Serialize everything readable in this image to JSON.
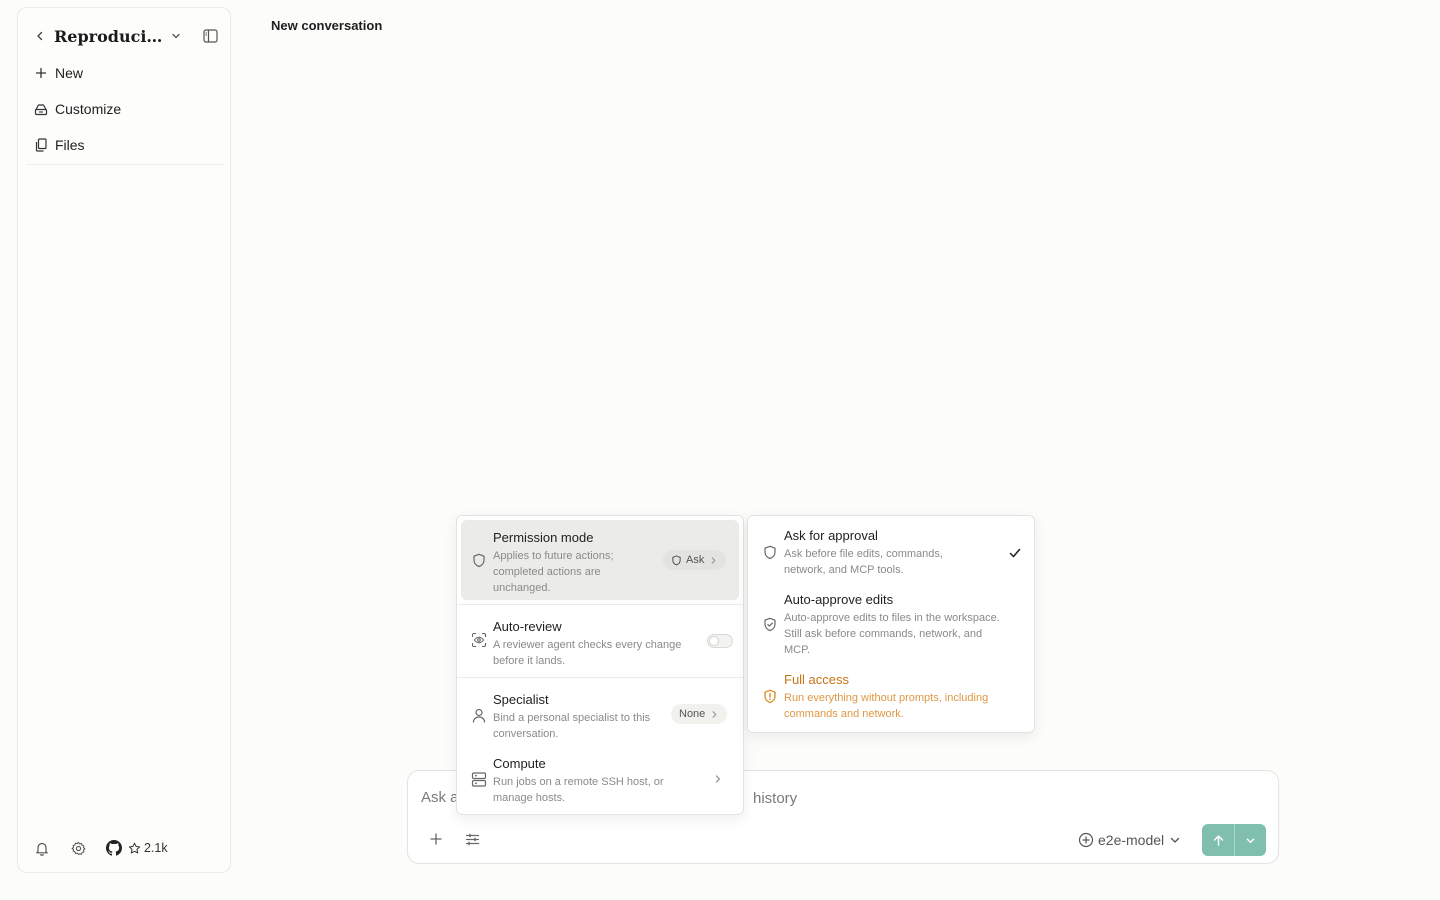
{
  "sidebar": {
    "project_title": "Reproducibl...",
    "items": [
      {
        "label": "New",
        "icon": "plus-icon"
      },
      {
        "label": "Customize",
        "icon": "customize-icon"
      },
      {
        "label": "Files",
        "icon": "files-icon"
      }
    ],
    "github_stars": "2.1k"
  },
  "header": {
    "title": "New conversation"
  },
  "composer": {
    "placeholder": "Ask a",
    "placeholder_tail": "history",
    "model": "e2e-model",
    "accent_color": "#7fbfac"
  },
  "menu": {
    "permission": {
      "title": "Permission mode",
      "desc_line1": "Applies to future actions;",
      "desc_line2": "completed actions are",
      "desc_line3": "unchanged.",
      "value": "Ask"
    },
    "auto_review": {
      "title": "Auto-review",
      "desc_line1": "A reviewer agent checks every change",
      "desc_line2": "before it lands.",
      "enabled": false
    },
    "specialist": {
      "title": "Specialist",
      "desc_line1": "Bind a personal specialist to this",
      "desc_line2": "conversation.",
      "value": "None"
    },
    "compute": {
      "title": "Compute",
      "desc_line1": "Run jobs on a remote SSH host, or",
      "desc_line2": "manage hosts."
    }
  },
  "permission_options": [
    {
      "title": "Ask for approval",
      "desc_line1": "Ask before file edits, commands,",
      "desc_line2": "network, and MCP tools.",
      "selected": true
    },
    {
      "title": "Auto-approve edits",
      "desc_line1": "Auto-approve edits to files in the workspace.",
      "desc_line2": "Still ask before commands, network, and",
      "desc_line3": "MCP.",
      "selected": false
    },
    {
      "title": "Full access",
      "desc_line1": "Run everything without prompts, including",
      "desc_line2": "commands and network.",
      "selected": false,
      "warn_color": "#c87515"
    }
  ]
}
